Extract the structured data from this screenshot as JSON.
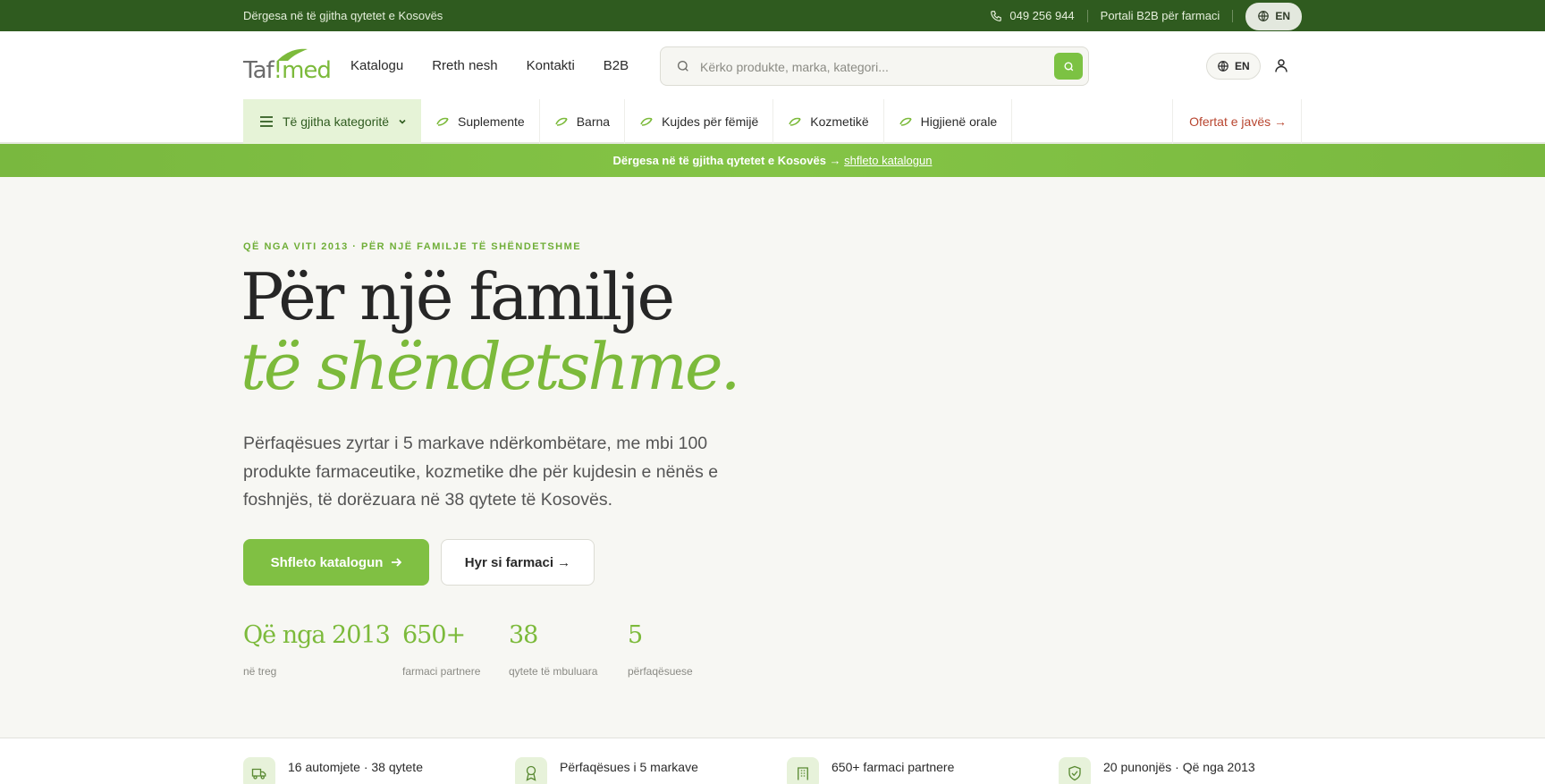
{
  "topbar": {
    "message": "Dërgesa në të gjitha qytetet e Kosovës",
    "phone": "049 256 944",
    "b2b_portal": "Portali B2B për farmaci",
    "lang": "EN"
  },
  "header": {
    "logo_text_a": "Taf",
    "logo_text_b": "!",
    "logo_text_c": "med",
    "nav": [
      "Katalogu",
      "Rreth nesh",
      "Kontakti",
      "B2B"
    ],
    "search_placeholder": "Kërko produkte, marka, kategori...",
    "lang": "EN"
  },
  "categories": {
    "all_label": "Të gjitha kategoritë",
    "items": [
      "Suplemente",
      "Barna",
      "Kujdes për fëmijë",
      "Kozmetikë",
      "Higjienë orale"
    ],
    "offers": "Ofertat e javës →"
  },
  "banner": {
    "text": "Dërgesa në të gjitha qytetet e Kosovës →",
    "link": "shfleto katalogun"
  },
  "hero": {
    "eyebrow": "QË NGA VITI 2013 · PËR NJË FAMILJE TË SHËNDETSHME",
    "title_line1": "Për një familje",
    "title_line2": "të shëndetshme.",
    "lead": "Përfaqësues zyrtar i 5 markave ndërkombëtare, me mbi 100 produkte farmaceutike, kozmetike dhe për kujdesin e nënës e foshnjës, të dorëzuara në 38 qytete të Kosovës.",
    "cta_primary": "Shfleto katalogun",
    "cta_secondary": "Hyr si farmaci →",
    "stats": [
      {
        "num": "Që nga 2013",
        "label": "në treg"
      },
      {
        "num": "650+",
        "label": "farmaci partnere"
      },
      {
        "num": "38",
        "label": "qytete të mbuluara"
      },
      {
        "num": "5",
        "label": "përfaqësuese"
      }
    ]
  },
  "features": [
    {
      "icon": "truck-icon",
      "text": "16 automjete · 38 qytete"
    },
    {
      "icon": "award-icon",
      "text": "Përfaqësues i 5 markave"
    },
    {
      "icon": "building-icon",
      "text": "650+ farmaci partnere"
    },
    {
      "icon": "shield-check-icon",
      "text": "20 punonjës · Që nga 2013"
    }
  ],
  "colors": {
    "topbar": "#2f5b1f",
    "accent": "#7cba3b",
    "offers": "#b8452f"
  }
}
